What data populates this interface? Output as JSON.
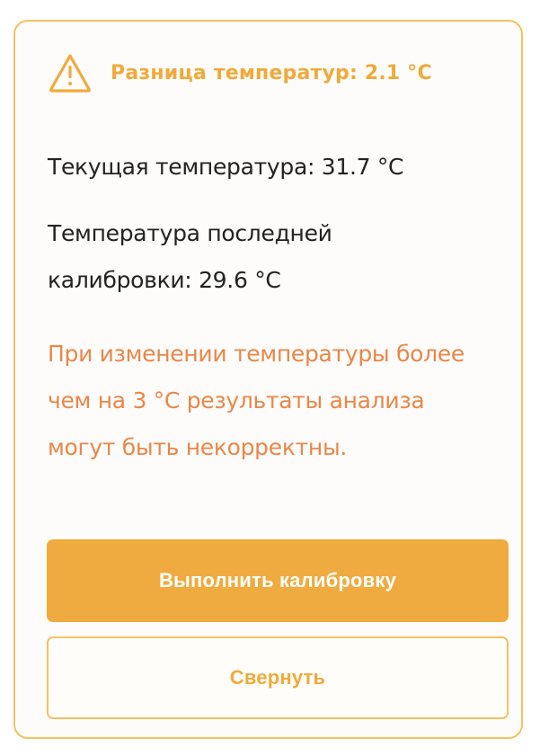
{
  "alert": {
    "icon": "warning-triangle-icon",
    "title": "Разница температур: 2.1 °C",
    "current_temperature": "Текущая температура: 31.7 °C",
    "last_calibration_temperature": "Температура последней калибровки: 29.6 °C",
    "warning_message": "При изменении температуры более чем на 3 °C результаты анализа могут быть некорректны."
  },
  "actions": {
    "calibrate_label": "Выполнить калибровку",
    "collapse_label": "Свернуть"
  },
  "colors": {
    "accent": "#efab3f",
    "border": "#f2c265",
    "warning_text": "#e7874a",
    "body_text": "#222222"
  }
}
